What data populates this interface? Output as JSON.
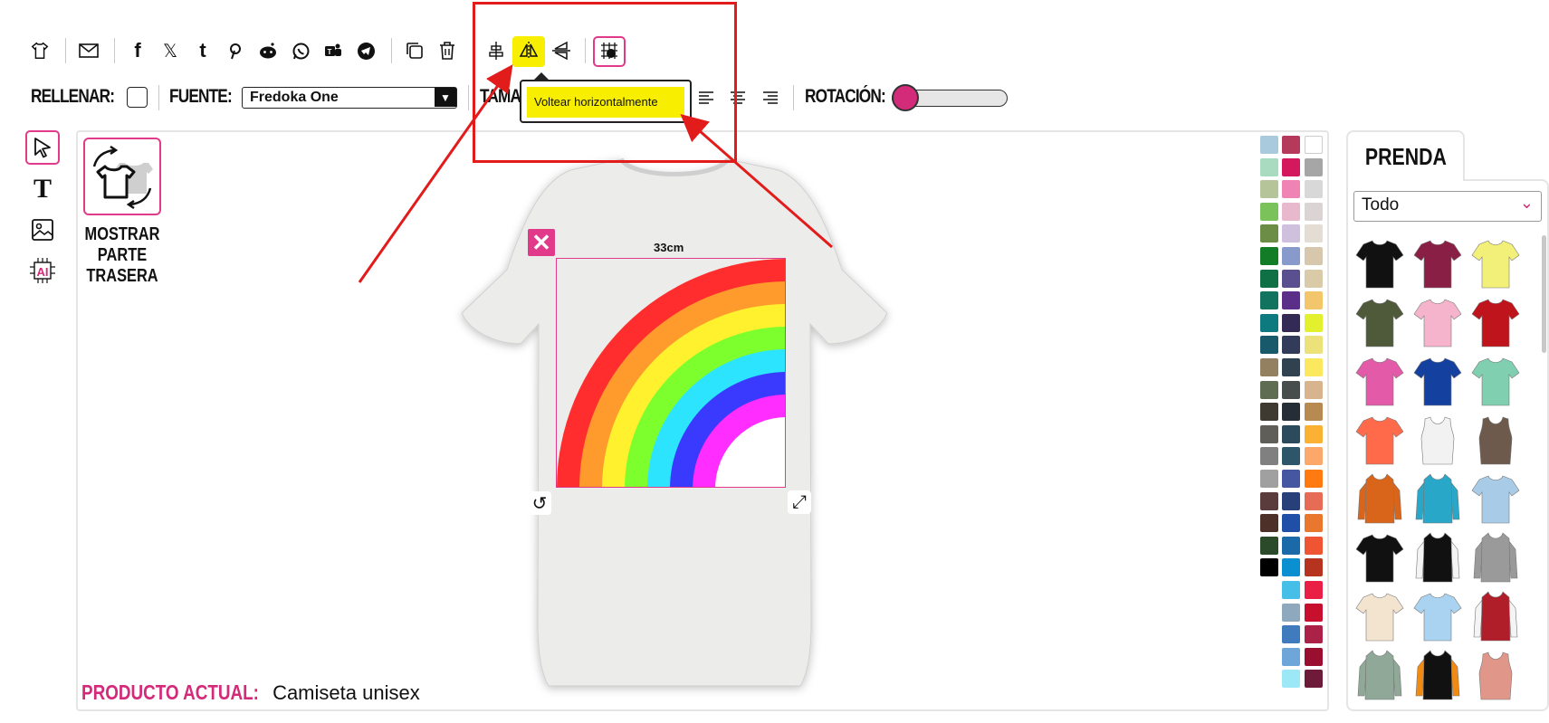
{
  "toolbar": {
    "icons": [
      "tshirt-icon",
      "email-icon",
      "facebook-icon",
      "x-icon",
      "tumblr-icon",
      "pinterest-icon",
      "reddit-icon",
      "whatsapp-icon",
      "teams-icon",
      "telegram-icon",
      "copy-icon",
      "trash-icon",
      "center-vertical-icon",
      "flip-horizontal-icon",
      "flip-vertical-icon",
      "grid-icon"
    ],
    "fill_label": "RELLENAR:",
    "font_label": "FUENTE:",
    "font_value": "Fredoka One",
    "size_label_partial": "TAMA",
    "rotation_label": "ROTACIÓN:",
    "rotation_value": 0,
    "tooltip": "Voltear horizontalmente"
  },
  "left_tools": [
    "select-tool",
    "text-tool",
    "image-tool",
    "ai-tool"
  ],
  "canvas": {
    "back_button_label": "MOSTRAR PARTE TRASERA",
    "design_size": "33cm",
    "product_label": "PRODUCTO ACTUAL:",
    "product_value": "Camiseta unisex"
  },
  "colors": {
    "accent": "#d32a7a",
    "annotation_red": "#e21b1b",
    "tooltip_yellow": "#f7ee00",
    "rainbow": [
      "#ff2d2d",
      "#ff9a2d",
      "#fff12d",
      "#7dff2d",
      "#2de4ff",
      "#3a3aff",
      "#ff2dff"
    ],
    "swatch_col1": [
      "#a9c9dd",
      "#a9dbc0",
      "#b6c49a",
      "#7cc25a",
      "#6c8d46",
      "#127d26",
      "#0f6f45",
      "#12745e",
      "#0d7a80",
      "#185a6c",
      "#928060",
      "#5e6d52",
      "#3e3a31",
      "#5f5e59",
      "#808080",
      "#a0a0a0",
      "#5a3c3c",
      "#4d3129",
      "#2b4a2a",
      "#000000"
    ],
    "swatch_col2": [
      "#b5395a",
      "#d4185e",
      "#ef84b4",
      "#e8b8cd",
      "#cfc1dd",
      "#8899cc",
      "#5a4f8f",
      "#5b2e8a",
      "#332a55",
      "#333b5a",
      "#30424f",
      "#464d4c",
      "#252e36",
      "#2b4a5c",
      "#2d566a",
      "#4657a2",
      "#27407a",
      "#1f4fa6",
      "#1a6aaa",
      "#0a8fd0",
      "#45bfe8",
      "#8ea8be",
      "#3f7bbd",
      "#6fa6da",
      "#9de8f7"
    ],
    "swatch_col3": [
      "#ffffff",
      "#a6a6a6",
      "#d8d8d8",
      "#dad4d4",
      "#e4ddd3",
      "#d7c7ad",
      "#d9cba8",
      "#f3c66c",
      "#e3f02d",
      "#ede27a",
      "#fbe85f",
      "#d7b38e",
      "#b78a52",
      "#fbb134",
      "#fba86a",
      "#ff7a10",
      "#e76c55",
      "#e9772e",
      "#ef5533",
      "#b5331f",
      "#ea1f45",
      "#c6102e",
      "#ac2147",
      "#9a0f2f",
      "#6e1a39"
    ]
  },
  "right_panel": {
    "tab_label": "PRENDA",
    "category_value": "Todo",
    "garment_icons": [
      "tshirt-black",
      "tshirt-maroon",
      "tshirt-yellow",
      "tshirt-olive",
      "tshirt-pink",
      "tshirt-red",
      "tshirt-magenta",
      "tshirt-royal-blue",
      "tshirt-mint",
      "tshirt-coral",
      "tank-white",
      "tank-brown",
      "hoodie-orange",
      "hoodie-teal",
      "tshirt-tie-dye",
      "tshirt-black-2",
      "raglan-black-white",
      "hoodie-grey",
      "tshirt-cream",
      "tshirt-light-blue",
      "jacket-red",
      "longsleeve-sage",
      "hoodie-black-orange",
      "tank-salmon"
    ]
  }
}
